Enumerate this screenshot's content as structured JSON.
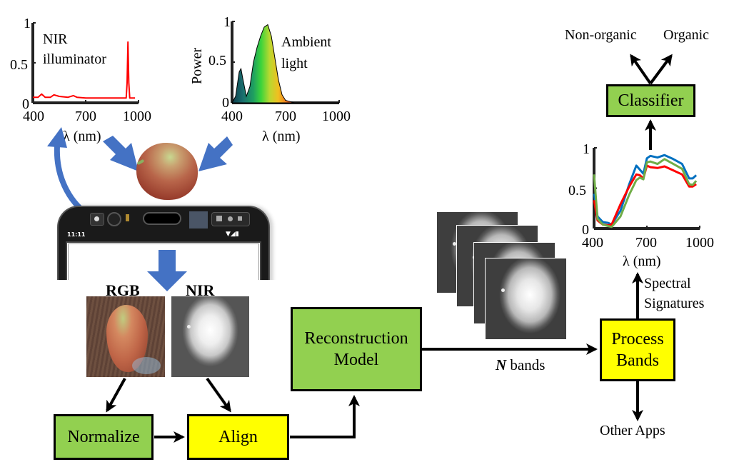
{
  "figure": {
    "nir_plot": {
      "label_line1": "NIR",
      "label_line2": "illuminator",
      "yticks": [
        "0",
        "0.5",
        "1"
      ],
      "xticks": [
        "400",
        "700",
        "1000"
      ],
      "xlabel": "λ (nm)",
      "color": "#ff0000"
    },
    "ambient_plot": {
      "label_line1": "Ambient",
      "label_line2": "light",
      "ylabel": "Power",
      "yticks": [
        "0",
        "0.5",
        "1"
      ],
      "xticks": [
        "400",
        "700",
        "1000"
      ],
      "xlabel": "λ (nm)"
    },
    "signature_plot": {
      "yticks": [
        "0",
        "0.5",
        "1"
      ],
      "xticks": [
        "400",
        "700",
        "1000"
      ],
      "xlabel": "λ (nm)",
      "series_colors": [
        "#0070c0",
        "#ff0000",
        "#70ad47"
      ]
    },
    "phone": {
      "status_time": "11:11"
    },
    "images": {
      "rgb_label": "RGB",
      "nir_label": "NIR"
    },
    "boxes": {
      "normalize": "Normalize",
      "align": "Align",
      "reconstruction_line1": "Reconstruction",
      "reconstruction_line2": "Model",
      "process_line1": "Process",
      "process_line2": "Bands",
      "classifier": "Classifier"
    },
    "labels": {
      "n_bands_n": "N",
      "n_bands_rest": " bands",
      "spectral_line1": "Spectral",
      "spectral_line2": "Signatures",
      "other_apps": "Other Apps",
      "non_organic": "Non-organic",
      "organic": "Organic"
    },
    "colors": {
      "green_box": "#92d050",
      "yellow_box": "#ffff00",
      "blue_arrow": "#4472c4"
    }
  },
  "chart_data": [
    {
      "type": "line",
      "title": "NIR illuminator",
      "xlabel": "λ (nm)",
      "ylabel": "",
      "xlim": [
        400,
        1000
      ],
      "ylim": [
        0,
        1
      ],
      "series": [
        {
          "name": "NIR illuminator",
          "color": "#ff0000",
          "x": [
            400,
            430,
            450,
            470,
            500,
            520,
            550,
            600,
            630,
            650,
            700,
            800,
            900,
            930,
            935,
            940,
            945,
            950,
            980
          ],
          "values": [
            0.07,
            0.07,
            0.11,
            0.07,
            0.07,
            0.1,
            0.08,
            0.07,
            0.09,
            0.07,
            0.06,
            0.06,
            0.06,
            0.06,
            0.25,
            0.76,
            0.25,
            0.06,
            0.06
          ]
        }
      ]
    },
    {
      "type": "area",
      "title": "Ambient light",
      "xlabel": "λ (nm)",
      "ylabel": "Power",
      "xlim": [
        400,
        1000
      ],
      "ylim": [
        0,
        1
      ],
      "series": [
        {
          "name": "Ambient light",
          "x": [
            400,
            420,
            440,
            450,
            460,
            480,
            500,
            520,
            540,
            560,
            580,
            600,
            620,
            640,
            660,
            680,
            700,
            750,
            800,
            1000
          ],
          "values": [
            0.0,
            0.08,
            0.38,
            0.42,
            0.3,
            0.08,
            0.2,
            0.5,
            0.68,
            0.82,
            0.93,
            0.96,
            0.82,
            0.55,
            0.28,
            0.1,
            0.03,
            0.0,
            0.0,
            0.0
          ]
        }
      ]
    },
    {
      "type": "line",
      "title": "Spectral Signatures",
      "xlabel": "λ (nm)",
      "ylabel": "",
      "xlim": [
        400,
        1000
      ],
      "ylim": [
        0,
        1
      ],
      "series": [
        {
          "name": "blue",
          "color": "#0070c0",
          "x": [
            400,
            420,
            450,
            480,
            500,
            550,
            600,
            640,
            660,
            680,
            700,
            720,
            760,
            800,
            850,
            900,
            940,
            960,
            980
          ],
          "values": [
            0.43,
            0.15,
            0.08,
            0.07,
            0.05,
            0.22,
            0.55,
            0.78,
            0.73,
            0.68,
            0.87,
            0.9,
            0.88,
            0.91,
            0.86,
            0.8,
            0.62,
            0.62,
            0.66
          ]
        },
        {
          "name": "red",
          "color": "#ff0000",
          "x": [
            400,
            420,
            450,
            480,
            500,
            550,
            600,
            640,
            660,
            680,
            700,
            720,
            760,
            800,
            850,
            900,
            940,
            960,
            980
          ],
          "values": [
            0.35,
            0.1,
            0.05,
            0.04,
            0.05,
            0.3,
            0.52,
            0.67,
            0.66,
            0.62,
            0.78,
            0.76,
            0.75,
            0.77,
            0.72,
            0.67,
            0.52,
            0.52,
            0.55
          ]
        },
        {
          "name": "green",
          "color": "#70ad47",
          "x": [
            400,
            420,
            450,
            480,
            500,
            550,
            600,
            640,
            660,
            680,
            700,
            720,
            760,
            800,
            850,
            900,
            940,
            960,
            980
          ],
          "values": [
            0.67,
            0.12,
            0.05,
            0.03,
            0.02,
            0.15,
            0.42,
            0.6,
            0.63,
            0.61,
            0.82,
            0.83,
            0.8,
            0.86,
            0.8,
            0.74,
            0.55,
            0.54,
            0.59
          ]
        }
      ]
    }
  ]
}
